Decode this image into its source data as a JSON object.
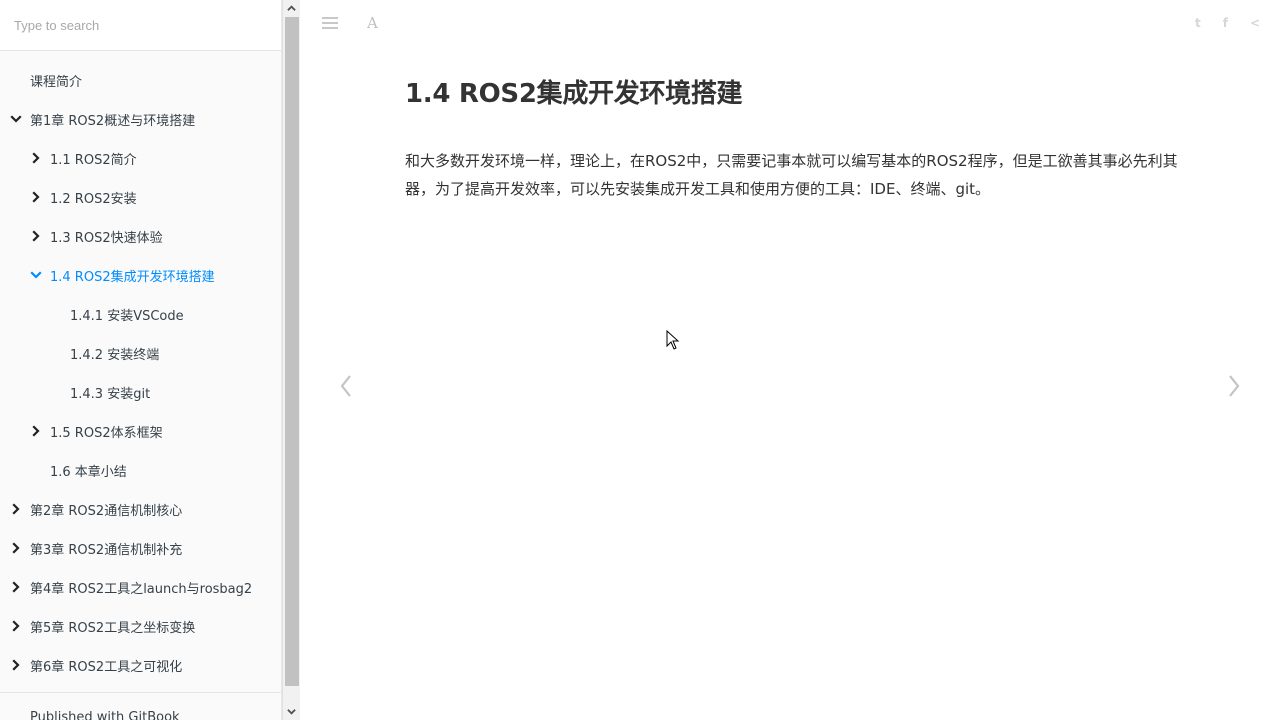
{
  "search": {
    "placeholder": "Type to search"
  },
  "sidebar": {
    "items": [
      {
        "label": "课程简介",
        "level": 0,
        "chevron": "none",
        "active": false
      },
      {
        "label": "第1章 ROS2概述与环境搭建",
        "level": 0,
        "chevron": "down",
        "active": false
      },
      {
        "label": "1.1 ROS2简介",
        "level": 1,
        "chevron": "right",
        "active": false
      },
      {
        "label": "1.2 ROS2安装",
        "level": 1,
        "chevron": "right",
        "active": false
      },
      {
        "label": "1.3 ROS2快速体验",
        "level": 1,
        "chevron": "right",
        "active": false
      },
      {
        "label": "1.4 ROS2集成开发环境搭建",
        "level": 1,
        "chevron": "down",
        "active": true
      },
      {
        "label": "1.4.1 安装VSCode",
        "level": 2,
        "chevron": "none",
        "active": false
      },
      {
        "label": "1.4.2 安装终端",
        "level": 2,
        "chevron": "none",
        "active": false
      },
      {
        "label": "1.4.3 安装git",
        "level": 2,
        "chevron": "none",
        "active": false
      },
      {
        "label": "1.5 ROS2体系框架",
        "level": 1,
        "chevron": "right",
        "active": false
      },
      {
        "label": "1.6 本章小结",
        "level": 1,
        "chevron": "none",
        "active": false
      },
      {
        "label": "第2章 ROS2通信机制核心",
        "level": 0,
        "chevron": "right",
        "active": false
      },
      {
        "label": "第3章 ROS2通信机制补充",
        "level": 0,
        "chevron": "right",
        "active": false
      },
      {
        "label": "第4章 ROS2工具之launch与rosbag2",
        "level": 0,
        "chevron": "right",
        "active": false
      },
      {
        "label": "第5章 ROS2工具之坐标变换",
        "level": 0,
        "chevron": "right",
        "active": false
      },
      {
        "label": "第6章 ROS2工具之可视化",
        "level": 0,
        "chevron": "right",
        "active": false
      }
    ],
    "footer": "Published with GitBook"
  },
  "toolbar": {
    "font_icon_glyph": "A",
    "share": [
      "t",
      "f",
      "<"
    ]
  },
  "main": {
    "title": "1.4 ROS2集成开发环境搭建",
    "paragraph": "和大多数开发环境一样，理论上，在ROS2中，只需要记事本就可以编写基本的ROS2程序，但是工欲善其事必先利其器，为了提高开发效率，可以先安装集成开发工具和使用方便的工具：IDE、终端、git。"
  },
  "colors": {
    "active": "#008cff",
    "text": "#333333",
    "sidebar_bg": "#fafafa"
  }
}
